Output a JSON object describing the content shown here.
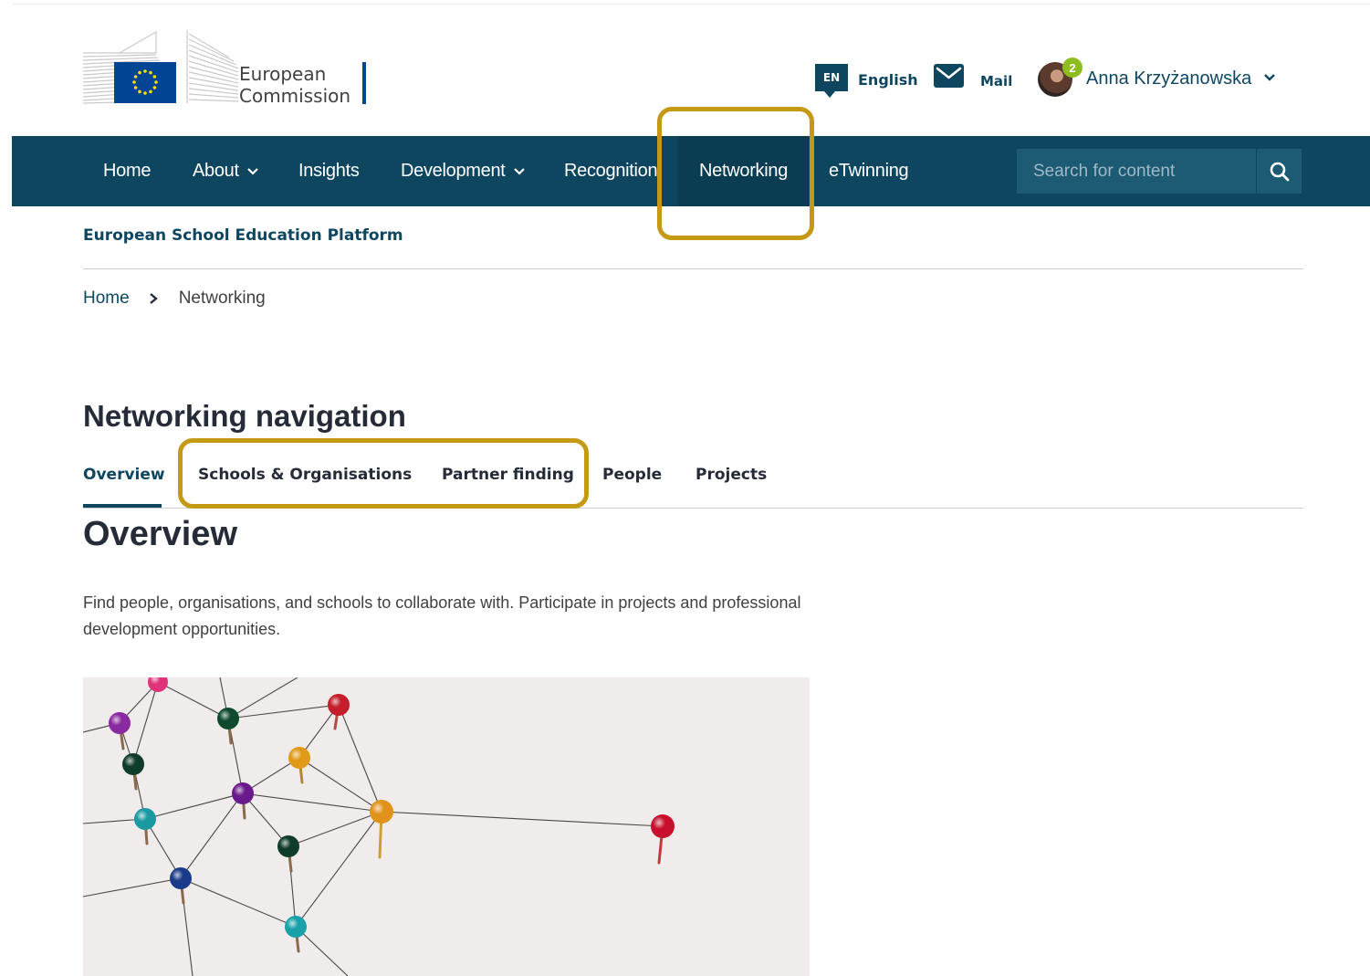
{
  "brand": {
    "name_line1": "European",
    "name_line2": "Commission"
  },
  "header": {
    "language_code": "EN",
    "language_label": "English",
    "mail_label": "Mail",
    "notification_count": "2",
    "user_name": "Anna Krzyżanowska"
  },
  "nav": {
    "items": [
      {
        "label": "Home"
      },
      {
        "label": "About"
      },
      {
        "label": "Insights"
      },
      {
        "label": "Development"
      },
      {
        "label": "Recognition"
      },
      {
        "label": "Networking"
      },
      {
        "label": "eTwinning"
      }
    ],
    "active": "Networking",
    "search_placeholder": "Search for content"
  },
  "site_name": "European School Education Platform",
  "breadcrumb": {
    "home": "Home",
    "current": "Networking"
  },
  "section_title": "Networking navigation",
  "tabs": [
    {
      "label": "Overview"
    },
    {
      "label": "Schools & Organisations"
    },
    {
      "label": "Partner finding"
    },
    {
      "label": "People"
    },
    {
      "label": "Projects"
    }
  ],
  "active_tab": "Overview",
  "page": {
    "heading": "Overview",
    "intro": "Find people, organisations, and schools to collaborate with. Participate in projects and professional development opportunities."
  },
  "colors": {
    "primary": "#0e4660",
    "highlight": "#c49a14",
    "badge": "#8ebd1f"
  }
}
